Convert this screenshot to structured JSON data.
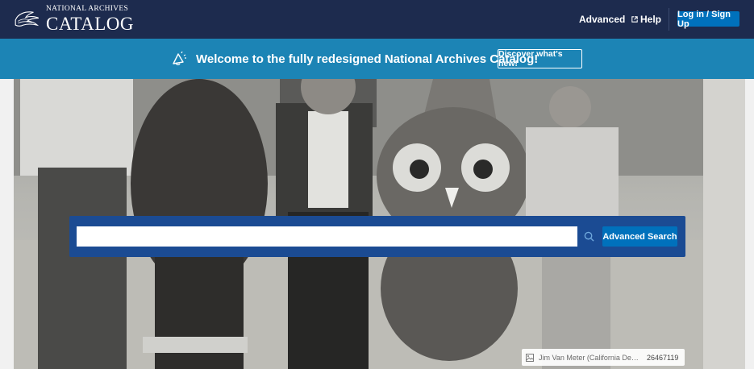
{
  "header": {
    "logo_small": "NATIONAL ARCHIVES",
    "logo_big": "CATALOG",
    "nav_advanced": "Advanced",
    "nav_help": "Help",
    "login_label": "Log in / Sign Up"
  },
  "banner": {
    "message": "Welcome to the fully redesigned National Archives Catalog!",
    "button_label": "Discover what's new!"
  },
  "search": {
    "value": "",
    "placeholder": "",
    "advanced_label": "Advanced Search"
  },
  "caption": {
    "credit": "Jim Van Meter (California Department of Forestry)",
    "record_id": "26467119"
  },
  "colors": {
    "header_bg": "#1d2b4e",
    "banner_bg": "#1c84b5",
    "search_panel": "#1b4b93",
    "button_blue": "#0071bc"
  },
  "icons": [
    "eagle-logo-icon",
    "announcement-icon",
    "external-link-icon",
    "search-icon",
    "image-icon"
  ]
}
